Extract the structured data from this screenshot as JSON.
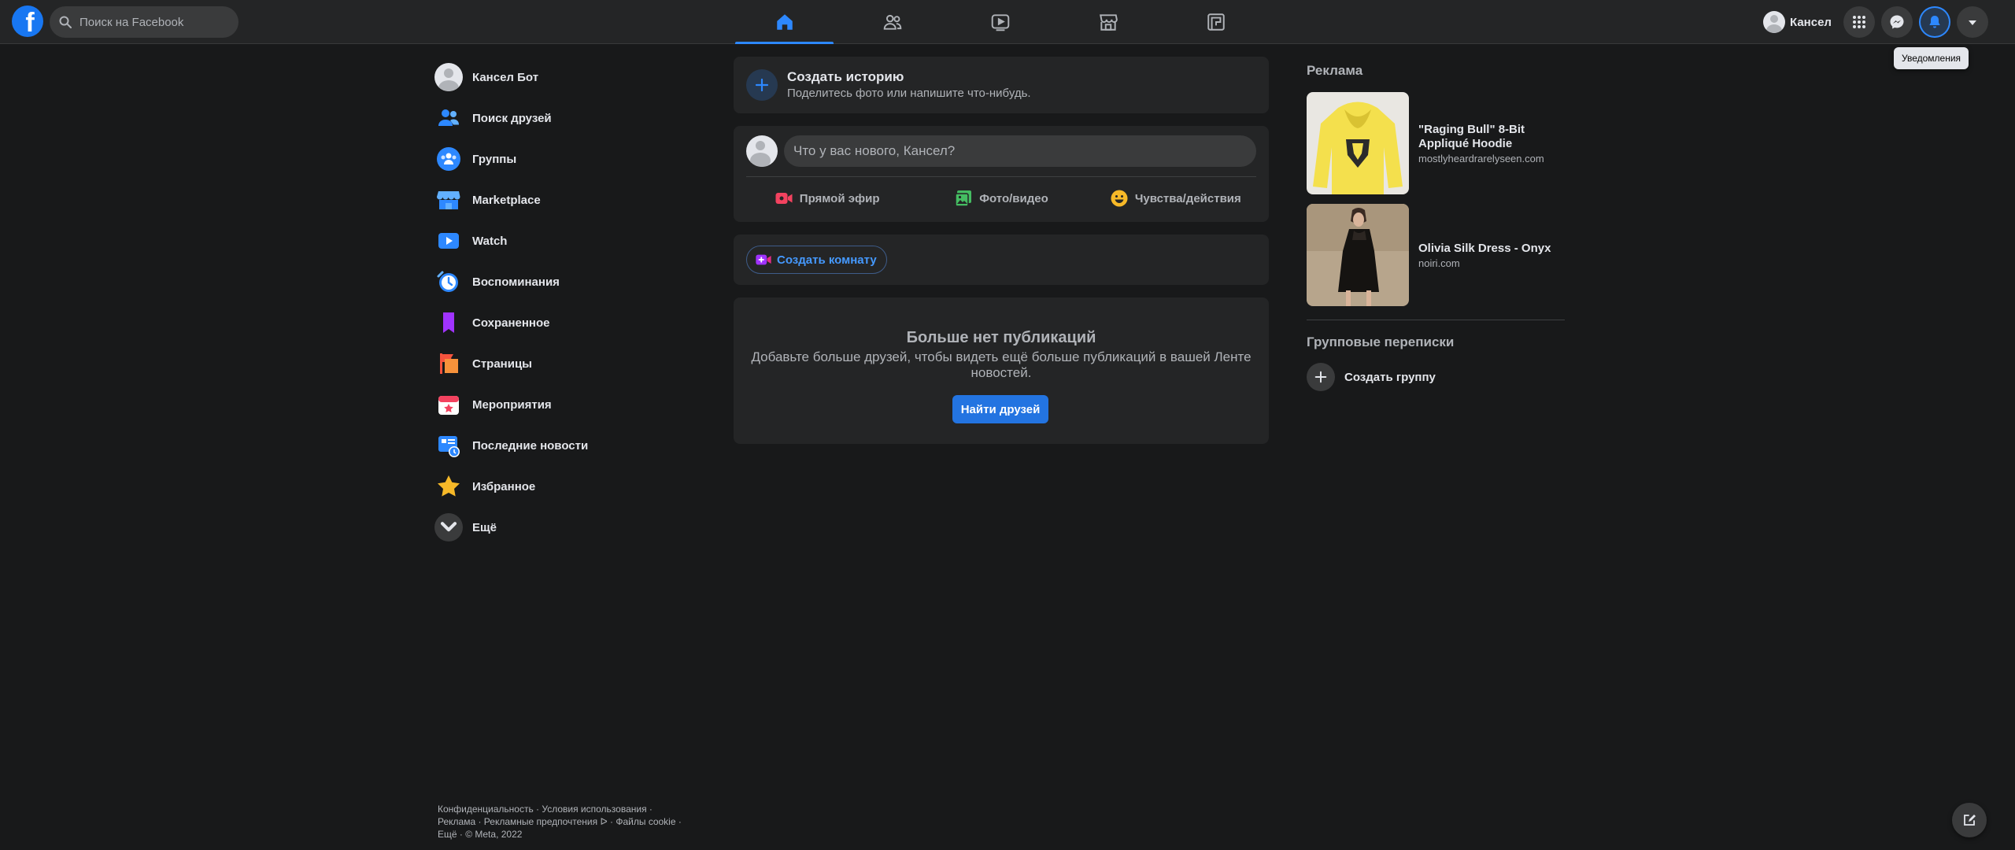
{
  "colors": {
    "accent": "#2d88ff",
    "background": "#18191a",
    "surface": "#242526",
    "button_primary": "#2374e1"
  },
  "header": {
    "logo_icon": "facebook-logo",
    "search_placeholder": "Поиск на Facebook",
    "nav_tabs": [
      {
        "icon": "home-icon",
        "active": true
      },
      {
        "icon": "friends-icon",
        "active": false
      },
      {
        "icon": "watch-icon",
        "active": false
      },
      {
        "icon": "marketplace-icon",
        "active": false
      },
      {
        "icon": "gaming-icon",
        "active": false
      }
    ],
    "profile_name": "Кансел",
    "buttons": [
      "menu-grid-icon",
      "messenger-icon",
      "bell-icon",
      "caret-down-icon"
    ],
    "tooltip": "Уведомления"
  },
  "sidebar": {
    "items": [
      {
        "label": "Кансел Бот",
        "icon": "avatar"
      },
      {
        "label": "Поиск друзей",
        "icon": "friends-icon"
      },
      {
        "label": "Группы",
        "icon": "groups-icon"
      },
      {
        "label": "Marketplace",
        "icon": "marketplace-icon"
      },
      {
        "label": "Watch",
        "icon": "watch-icon"
      },
      {
        "label": "Воспоминания",
        "icon": "memories-icon"
      },
      {
        "label": "Сохраненное",
        "icon": "saved-icon"
      },
      {
        "label": "Страницы",
        "icon": "pages-icon"
      },
      {
        "label": "Мероприятия",
        "icon": "events-icon"
      },
      {
        "label": "Последние новости",
        "icon": "recent-news-icon"
      },
      {
        "label": "Избранное",
        "icon": "star-icon"
      },
      {
        "label": "Ещё",
        "icon": "chevron-down-icon"
      }
    ]
  },
  "footer": {
    "line1": "Конфиденциальность · Условия использования ·",
    "line2": "Реклама · Рекламные предпочтения ᐅ · Файлы cookie ·",
    "line3": "Ещё · © Meta, 2022"
  },
  "feed": {
    "story": {
      "title": "Создать историю",
      "subtitle": "Поделитесь фото или напишите что-нибудь."
    },
    "composer": {
      "placeholder": "Что у вас нового, Кансел?",
      "actions": [
        {
          "label": "Прямой эфир",
          "icon": "live-video-icon",
          "color": "#f3425f"
        },
        {
          "label": "Фото/видео",
          "icon": "photo-icon",
          "color": "#45bd62"
        },
        {
          "label": "Чувства/действия",
          "icon": "feeling-icon",
          "color": "#f7b928"
        }
      ]
    },
    "room_button": "Создать комнату",
    "empty": {
      "title": "Больше нет публикаций",
      "description": "Добавьте больше друзей, чтобы видеть ещё больше публикаций в вашей Ленте новостей.",
      "button": "Найти друзей"
    }
  },
  "right": {
    "ads_title": "Реклама",
    "ads": [
      {
        "title": "\"Raging Bull\" 8-Bit Appliqué Hoodie",
        "domain": "mostlyheardrarelyseen.com"
      },
      {
        "title": "Olivia Silk Dress - Onyx",
        "domain": "noiri.com"
      }
    ],
    "group_chats_title": "Групповые переписки",
    "create_group": "Создать группу"
  }
}
